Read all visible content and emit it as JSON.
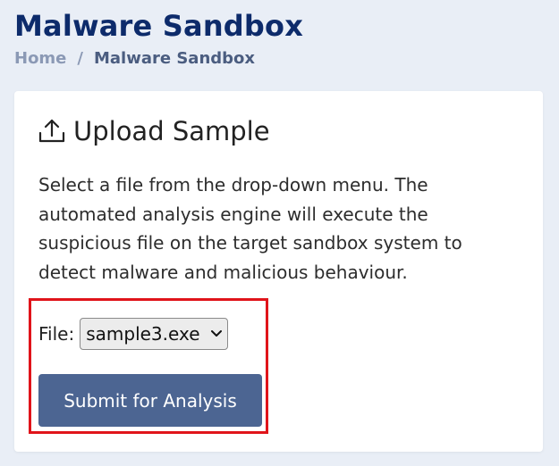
{
  "header": {
    "title": "Malware Sandbox"
  },
  "breadcrumb": {
    "home": "Home",
    "separator": "/",
    "current": "Malware Sandbox"
  },
  "card": {
    "icon": "upload-icon",
    "title": "Upload Sample",
    "description": "Select a file from the drop-down menu. The automated analysis engine will execute the suspicious file on the target sandbox system to detect malware and malicious behaviour.",
    "file_label": "File:",
    "selected_file": "sample3.exe",
    "submit_label": "Submit for Analysis"
  },
  "colors": {
    "title": "#0d2b6b",
    "button": "#4c6592",
    "highlight": "#e0141a",
    "background": "#e9eef6"
  }
}
